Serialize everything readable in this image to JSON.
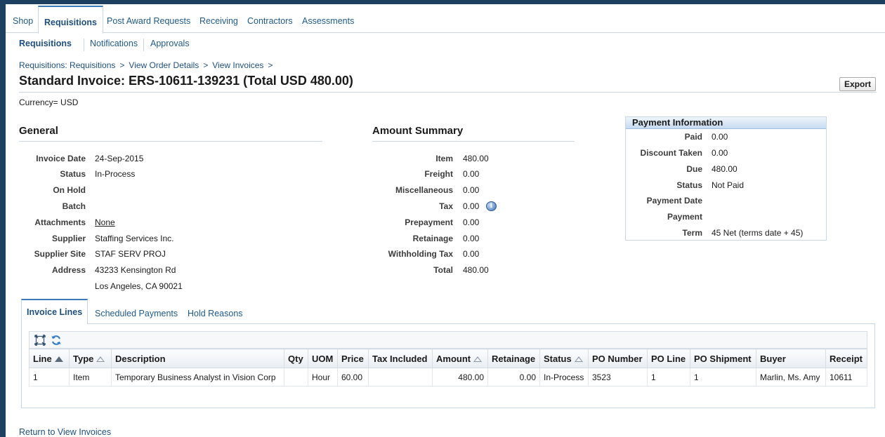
{
  "tabs": [
    {
      "label": "Shop"
    },
    {
      "label": "Requisitions"
    },
    {
      "label": "Post Award Requests"
    },
    {
      "label": "Receiving"
    },
    {
      "label": "Contractors"
    },
    {
      "label": "Assessments"
    }
  ],
  "subtabs": [
    {
      "label": "Requisitions"
    },
    {
      "label": "Notifications"
    },
    {
      "label": "Approvals"
    }
  ],
  "breadcrumb": [
    {
      "label": "Requisitions: Requisitions"
    },
    {
      "label": "View Order Details"
    },
    {
      "label": "View Invoices"
    }
  ],
  "breadcrumb_sep": ">",
  "page_title": "Standard Invoice: ERS-10611-139231 (Total USD 480.00)",
  "export_label": "Export",
  "currency": "Currency=  USD",
  "general": {
    "heading": "General",
    "fields": [
      {
        "label": "Invoice Date",
        "value": "24-Sep-2015"
      },
      {
        "label": "Status",
        "value": "In-Process"
      },
      {
        "label": "On Hold",
        "value": ""
      },
      {
        "label": "Batch",
        "value": ""
      },
      {
        "label": "Attachments",
        "value": "None"
      },
      {
        "label": "Supplier",
        "value": "Staffing Services Inc."
      },
      {
        "label": "Supplier Site",
        "value": "STAF SERV PROJ"
      },
      {
        "label": "Address",
        "value": "43233 Kensington Rd"
      }
    ],
    "address_line2": "Los Angeles, CA 90021"
  },
  "amount_summary": {
    "heading": "Amount Summary",
    "fields": [
      {
        "label": "Item",
        "value": "480.00"
      },
      {
        "label": "Freight",
        "value": "0.00"
      },
      {
        "label": "Miscellaneous",
        "value": "0.00"
      },
      {
        "label": "Tax",
        "value": "0.00"
      },
      {
        "label": "Prepayment",
        "value": "0.00"
      },
      {
        "label": "Retainage",
        "value": "0.00"
      },
      {
        "label": "Withholding Tax",
        "value": "0.00"
      },
      {
        "label": "Total",
        "value": "480.00"
      }
    ],
    "info_icon": "info-icon"
  },
  "payment": {
    "heading": "Payment Information",
    "fields": [
      {
        "label": "Paid",
        "value": "0.00"
      },
      {
        "label": "Discount Taken",
        "value": "0.00"
      },
      {
        "label": "Due",
        "value": "480.00"
      },
      {
        "label": "Status",
        "value": "Not Paid"
      },
      {
        "label": "Payment Date",
        "value": ""
      },
      {
        "label": "Payment",
        "value": ""
      },
      {
        "label": "Term",
        "value": "45 Net (terms date + 45)"
      }
    ]
  },
  "inner_tabs": [
    {
      "label": "Invoice Lines"
    },
    {
      "label": "Scheduled Payments"
    },
    {
      "label": "Hold Reasons"
    }
  ],
  "toolbar_icons": [
    "detach-icon",
    "refresh-icon"
  ],
  "table": {
    "columns": [
      "Line",
      "Type",
      "Description",
      "Qty",
      "UOM",
      "Price",
      "Tax Included",
      "Amount",
      "Retainage",
      "Status",
      "PO Number",
      "PO Line",
      "PO Shipment",
      "Buyer",
      "Receipt"
    ],
    "rows": [
      {
        "line": "1",
        "type": "Item",
        "description": "Temporary Business Analyst in Vision Corp",
        "qty": "",
        "uom": "Hour",
        "price": "60.00",
        "tax_included": "",
        "amount": "480.00",
        "retainage": "0.00",
        "status": "In-Process",
        "po_number": "3523",
        "po_line": "1",
        "po_shipment": "1",
        "buyer": "Marlin, Ms. Amy",
        "receipt": "10611"
      }
    ]
  },
  "return_link": "Return to View Invoices",
  "colors": {
    "link": "#1e4f80",
    "border": "#c9d7e5",
    "frame": "#1d4060"
  }
}
